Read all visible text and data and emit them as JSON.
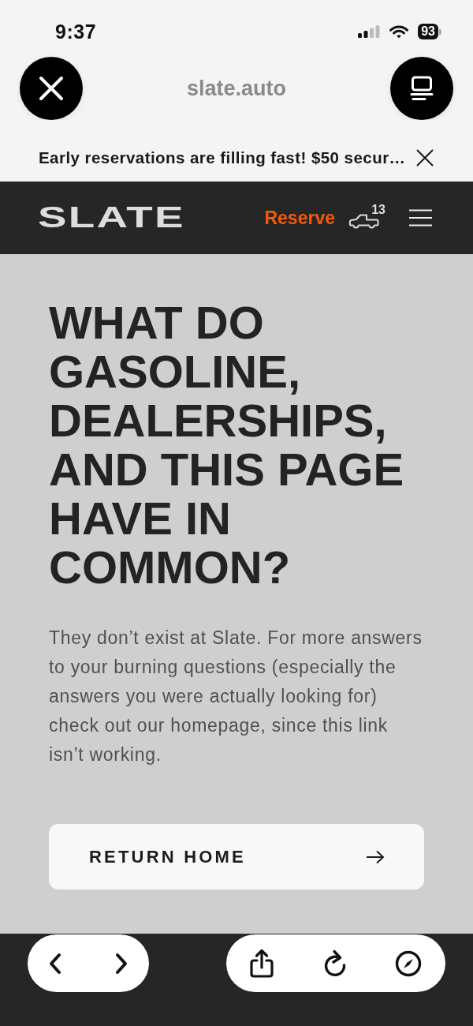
{
  "status_bar": {
    "time": "9:37",
    "battery": "93"
  },
  "browser": {
    "url": "slate.auto"
  },
  "banner": {
    "text": "Early reservations are filling fast! $50 secur…"
  },
  "nav": {
    "logo": "SLATE",
    "reserve": "Reserve",
    "truck_count": "13"
  },
  "hero": {
    "heading": "WHAT DO GASOLINE, DEALERSHIPS, AND THIS PAGE HAVE IN COMMON?",
    "body": "They don’t exist at Slate. For more answers to your burning questions (especially the answers you were actually looking for) check out our homepage, since this link isn’t working.",
    "button": "RETURN HOME"
  }
}
